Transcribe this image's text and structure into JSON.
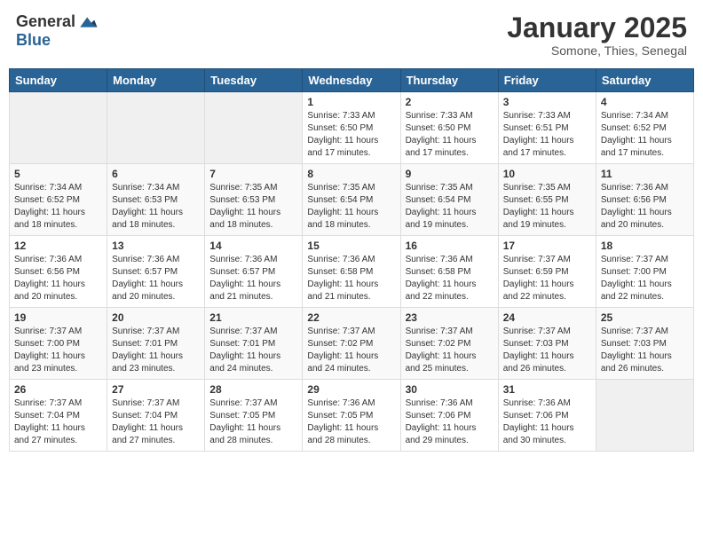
{
  "header": {
    "logo_general": "General",
    "logo_blue": "Blue",
    "month_title": "January 2025",
    "location": "Somone, Thies, Senegal"
  },
  "weekdays": [
    "Sunday",
    "Monday",
    "Tuesday",
    "Wednesday",
    "Thursday",
    "Friday",
    "Saturday"
  ],
  "weeks": [
    [
      {
        "day": "",
        "info": ""
      },
      {
        "day": "",
        "info": ""
      },
      {
        "day": "",
        "info": ""
      },
      {
        "day": "1",
        "info": "Sunrise: 7:33 AM\nSunset: 6:50 PM\nDaylight: 11 hours\nand 17 minutes."
      },
      {
        "day": "2",
        "info": "Sunrise: 7:33 AM\nSunset: 6:50 PM\nDaylight: 11 hours\nand 17 minutes."
      },
      {
        "day": "3",
        "info": "Sunrise: 7:33 AM\nSunset: 6:51 PM\nDaylight: 11 hours\nand 17 minutes."
      },
      {
        "day": "4",
        "info": "Sunrise: 7:34 AM\nSunset: 6:52 PM\nDaylight: 11 hours\nand 17 minutes."
      }
    ],
    [
      {
        "day": "5",
        "info": "Sunrise: 7:34 AM\nSunset: 6:52 PM\nDaylight: 11 hours\nand 18 minutes."
      },
      {
        "day": "6",
        "info": "Sunrise: 7:34 AM\nSunset: 6:53 PM\nDaylight: 11 hours\nand 18 minutes."
      },
      {
        "day": "7",
        "info": "Sunrise: 7:35 AM\nSunset: 6:53 PM\nDaylight: 11 hours\nand 18 minutes."
      },
      {
        "day": "8",
        "info": "Sunrise: 7:35 AM\nSunset: 6:54 PM\nDaylight: 11 hours\nand 18 minutes."
      },
      {
        "day": "9",
        "info": "Sunrise: 7:35 AM\nSunset: 6:54 PM\nDaylight: 11 hours\nand 19 minutes."
      },
      {
        "day": "10",
        "info": "Sunrise: 7:35 AM\nSunset: 6:55 PM\nDaylight: 11 hours\nand 19 minutes."
      },
      {
        "day": "11",
        "info": "Sunrise: 7:36 AM\nSunset: 6:56 PM\nDaylight: 11 hours\nand 20 minutes."
      }
    ],
    [
      {
        "day": "12",
        "info": "Sunrise: 7:36 AM\nSunset: 6:56 PM\nDaylight: 11 hours\nand 20 minutes."
      },
      {
        "day": "13",
        "info": "Sunrise: 7:36 AM\nSunset: 6:57 PM\nDaylight: 11 hours\nand 20 minutes."
      },
      {
        "day": "14",
        "info": "Sunrise: 7:36 AM\nSunset: 6:57 PM\nDaylight: 11 hours\nand 21 minutes."
      },
      {
        "day": "15",
        "info": "Sunrise: 7:36 AM\nSunset: 6:58 PM\nDaylight: 11 hours\nand 21 minutes."
      },
      {
        "day": "16",
        "info": "Sunrise: 7:36 AM\nSunset: 6:58 PM\nDaylight: 11 hours\nand 22 minutes."
      },
      {
        "day": "17",
        "info": "Sunrise: 7:37 AM\nSunset: 6:59 PM\nDaylight: 11 hours\nand 22 minutes."
      },
      {
        "day": "18",
        "info": "Sunrise: 7:37 AM\nSunset: 7:00 PM\nDaylight: 11 hours\nand 22 minutes."
      }
    ],
    [
      {
        "day": "19",
        "info": "Sunrise: 7:37 AM\nSunset: 7:00 PM\nDaylight: 11 hours\nand 23 minutes."
      },
      {
        "day": "20",
        "info": "Sunrise: 7:37 AM\nSunset: 7:01 PM\nDaylight: 11 hours\nand 23 minutes."
      },
      {
        "day": "21",
        "info": "Sunrise: 7:37 AM\nSunset: 7:01 PM\nDaylight: 11 hours\nand 24 minutes."
      },
      {
        "day": "22",
        "info": "Sunrise: 7:37 AM\nSunset: 7:02 PM\nDaylight: 11 hours\nand 24 minutes."
      },
      {
        "day": "23",
        "info": "Sunrise: 7:37 AM\nSunset: 7:02 PM\nDaylight: 11 hours\nand 25 minutes."
      },
      {
        "day": "24",
        "info": "Sunrise: 7:37 AM\nSunset: 7:03 PM\nDaylight: 11 hours\nand 26 minutes."
      },
      {
        "day": "25",
        "info": "Sunrise: 7:37 AM\nSunset: 7:03 PM\nDaylight: 11 hours\nand 26 minutes."
      }
    ],
    [
      {
        "day": "26",
        "info": "Sunrise: 7:37 AM\nSunset: 7:04 PM\nDaylight: 11 hours\nand 27 minutes."
      },
      {
        "day": "27",
        "info": "Sunrise: 7:37 AM\nSunset: 7:04 PM\nDaylight: 11 hours\nand 27 minutes."
      },
      {
        "day": "28",
        "info": "Sunrise: 7:37 AM\nSunset: 7:05 PM\nDaylight: 11 hours\nand 28 minutes."
      },
      {
        "day": "29",
        "info": "Sunrise: 7:36 AM\nSunset: 7:05 PM\nDaylight: 11 hours\nand 28 minutes."
      },
      {
        "day": "30",
        "info": "Sunrise: 7:36 AM\nSunset: 7:06 PM\nDaylight: 11 hours\nand 29 minutes."
      },
      {
        "day": "31",
        "info": "Sunrise: 7:36 AM\nSunset: 7:06 PM\nDaylight: 11 hours\nand 30 minutes."
      },
      {
        "day": "",
        "info": ""
      }
    ]
  ]
}
